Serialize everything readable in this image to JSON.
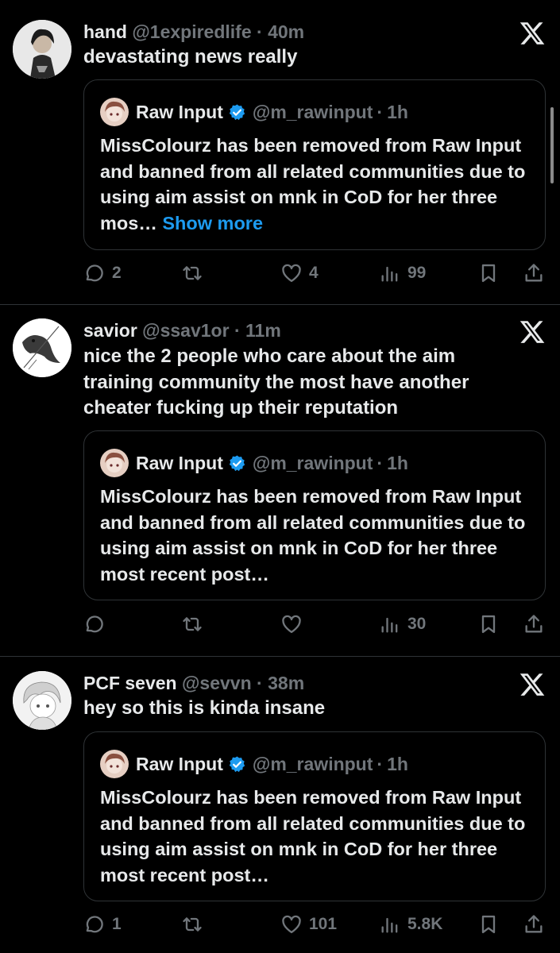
{
  "colors": {
    "background": "#000000",
    "text": "#e7e9ea",
    "secondary": "#71767b",
    "link": "#1d9bf0",
    "border": "#2f3336",
    "verified": "#1d9bf0"
  },
  "tweets": [
    {
      "name": "hand",
      "handle": "@1expiredlife",
      "separator": "·",
      "time": "40m",
      "text": "devastating news really",
      "logo_icon": "x-logo-icon",
      "quote": {
        "name": "Raw Input",
        "handle": "@m_rawinput",
        "separator": "·",
        "time": "1h",
        "text": "MissColourz has been removed from Raw Input and banned from all related communities due to using aim assist on mnk in CoD for her three mos…",
        "show_more": "Show more"
      },
      "actions": {
        "replies": "2",
        "reposts": "",
        "likes": "4",
        "views": "99"
      }
    },
    {
      "name": "savior",
      "handle": "@ssav1or",
      "separator": "·",
      "time": "11m",
      "text": "nice the 2 people who care about the aim training community the most have another cheater fucking up their reputation",
      "logo_icon": "x-logo-icon",
      "quote": {
        "name": "Raw Input",
        "handle": "@m_rawinput",
        "separator": "·",
        "time": "1h",
        "text": "MissColourz has been removed from Raw Input and banned from all related communities due to using aim assist on mnk in CoD for her three most recent post…",
        "show_more": ""
      },
      "actions": {
        "replies": "",
        "reposts": "",
        "likes": "",
        "views": "30"
      }
    },
    {
      "name": "PCF seven",
      "handle": "@sevvn",
      "separator": "·",
      "time": "38m",
      "text": "hey so this is kinda insane",
      "logo_icon": "x-logo-icon",
      "quote": {
        "name": "Raw Input",
        "handle": "@m_rawinput",
        "separator": "·",
        "time": "1h",
        "text": "MissColourz has been removed from Raw Input and banned from all related communities due to using aim assist on mnk in CoD for her three most recent post…",
        "show_more": ""
      },
      "actions": {
        "replies": "1",
        "reposts": "",
        "likes": "101",
        "views": "5.8K"
      }
    }
  ]
}
